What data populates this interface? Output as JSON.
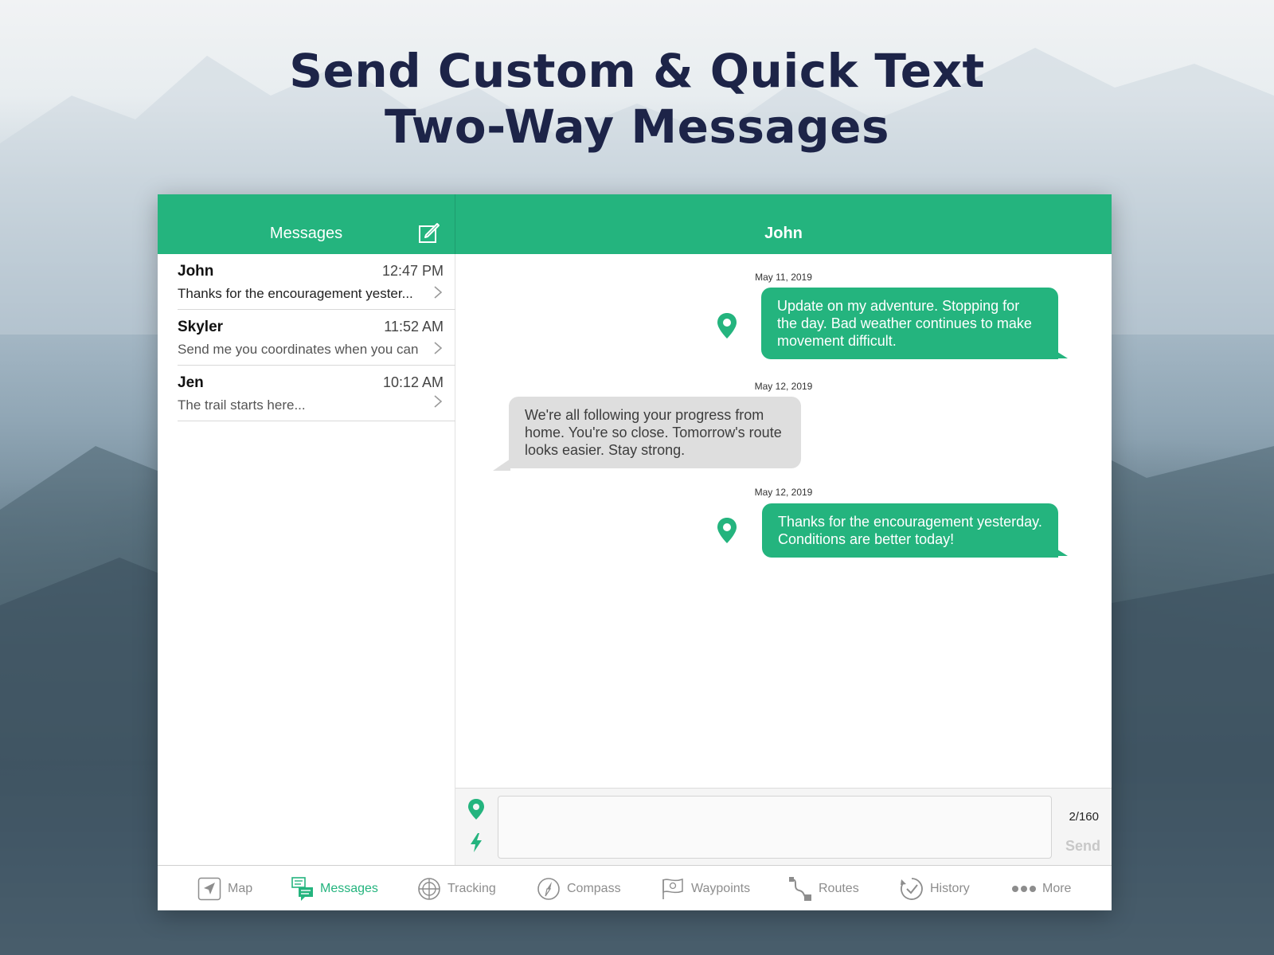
{
  "headline": {
    "line1": "Send Custom & Quick Text",
    "line2": "Two-Way Messages"
  },
  "colors": {
    "accent": "#24b47e",
    "headline": "#1d2448",
    "incoming_bubble": "#dedede",
    "tab_inactive": "#8d8d8d"
  },
  "messages_panel": {
    "title": "Messages",
    "compose_icon": "compose-icon",
    "conversations": [
      {
        "name": "John",
        "time": "12:47 PM",
        "preview": "Thanks for the encouragement yester..."
      },
      {
        "name": "Skyler",
        "time": "11:52 AM",
        "preview": "Send me you coordinates when you can"
      },
      {
        "name": "Jen",
        "time": "10:12 AM",
        "preview": "The trail starts here..."
      }
    ]
  },
  "chat": {
    "title": "John",
    "messages": [
      {
        "date": "May 11, 2019",
        "direction": "outgoing",
        "has_location": true,
        "text": "Update on my adventure. Stopping for the day. Bad weather continues to make movement difficult."
      },
      {
        "date": "May 12, 2019",
        "direction": "incoming",
        "has_location": false,
        "text": "We're all following your progress from home. You're so close. Tomorrow's route looks easier. Stay strong."
      },
      {
        "date": "May 12, 2019",
        "direction": "outgoing",
        "has_location": true,
        "text": "Thanks for the encouragement yesterday. Conditions are better today!"
      }
    ]
  },
  "composer": {
    "input_value": "",
    "counter": "2/160",
    "send_label": "Send",
    "location_icon": "location-pin-icon",
    "quick_text_icon": "lightning-bolt-icon"
  },
  "tabbar": {
    "active": "Messages",
    "tabs": [
      {
        "label": "Map",
        "icon": "navigation-arrow-icon"
      },
      {
        "label": "Messages",
        "icon": "chat-bubbles-icon"
      },
      {
        "label": "Tracking",
        "icon": "crosshair-circle-icon"
      },
      {
        "label": "Compass",
        "icon": "compass-icon"
      },
      {
        "label": "Waypoints",
        "icon": "waypoint-flag-icon"
      },
      {
        "label": "Routes",
        "icon": "route-path-icon"
      },
      {
        "label": "History",
        "icon": "history-clock-icon"
      },
      {
        "label": "More",
        "icon": "more-dots-icon"
      }
    ]
  }
}
